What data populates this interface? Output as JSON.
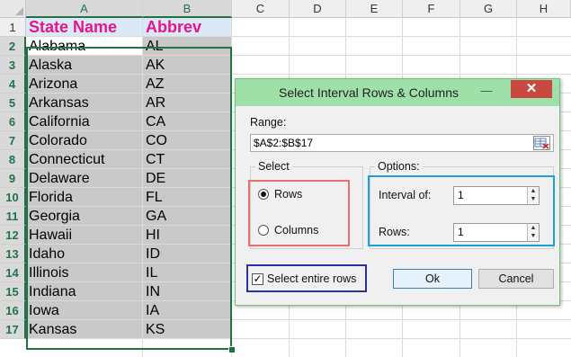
{
  "columns": [
    "A",
    "B",
    "C",
    "D",
    "E",
    "F",
    "G",
    "H"
  ],
  "rows": [
    "1",
    "2",
    "3",
    "4",
    "5",
    "6",
    "7",
    "8",
    "9",
    "10",
    "11",
    "12",
    "13",
    "14",
    "15",
    "16",
    "17"
  ],
  "header_row": {
    "a": "State Name",
    "b": "Abbrev"
  },
  "data_rows": [
    {
      "a": "Alabama",
      "b": "AL"
    },
    {
      "a": "Alaska",
      "b": "AK"
    },
    {
      "a": "Arizona",
      "b": "AZ"
    },
    {
      "a": "Arkansas",
      "b": "AR"
    },
    {
      "a": "California",
      "b": "CA"
    },
    {
      "a": "Colorado",
      "b": "CO"
    },
    {
      "a": "Connecticut",
      "b": "CT"
    },
    {
      "a": "Delaware",
      "b": "DE"
    },
    {
      "a": "Florida",
      "b": "FL"
    },
    {
      "a": "Georgia",
      "b": "GA"
    },
    {
      "a": "Hawaii",
      "b": "HI"
    },
    {
      "a": "Idaho",
      "b": "ID"
    },
    {
      "a": "Illinois",
      "b": "IL"
    },
    {
      "a": "Indiana",
      "b": "IN"
    },
    {
      "a": "Iowa",
      "b": "IA"
    },
    {
      "a": "Kansas",
      "b": "KS"
    }
  ],
  "dialog": {
    "title": "Select Interval Rows & Columns",
    "minimize_icon": "minimize-icon",
    "close_icon": "close-icon",
    "close_label": "✕",
    "range_label": "Range:",
    "range_value": "$A$2:$B$17",
    "range_picker_icon": "range-picker-icon",
    "select_group_label": "Select",
    "rows_option": "Rows",
    "columns_option": "Columns",
    "selected_option": "Rows",
    "options_group_label": "Options:",
    "interval_label": "Interval of:",
    "interval_value": "1",
    "rows_label": "Rows:",
    "rows_value": "1",
    "select_entire_rows_label": "Select entire rows",
    "select_entire_rows_checked": true,
    "ok_label": "Ok",
    "cancel_label": "Cancel"
  },
  "colors": {
    "header_text": "#e7138a",
    "header_fill": "#dbe9f7",
    "selection_fill": "#c9c9c9",
    "selection_border": "#217346",
    "titlebar": "#9fe0a8",
    "close_button": "#c9483f",
    "highlight_red": "#e8706a",
    "highlight_blue": "#1a9fd6",
    "highlight_navy": "#2d2fa0"
  }
}
